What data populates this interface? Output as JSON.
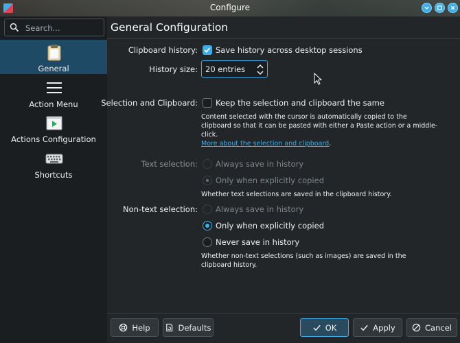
{
  "window": {
    "title": "Configure"
  },
  "search": {
    "placeholder": "Search..."
  },
  "sidebar": {
    "items": [
      {
        "label": "General",
        "icon": "clipboard-icon",
        "selected": true
      },
      {
        "label": "Action Menu",
        "icon": "menu-lines-icon",
        "selected": false
      },
      {
        "label": "Actions Configuration",
        "icon": "play-window-icon",
        "selected": false
      },
      {
        "label": "Shortcuts",
        "icon": "keyboard-icon",
        "selected": false
      }
    ]
  },
  "page": {
    "title": "General Configuration"
  },
  "clipboard_history": {
    "label": "Clipboard history:",
    "option": "Save history across desktop sessions",
    "checked": true
  },
  "history_size": {
    "label": "History size:",
    "value": "20 entries"
  },
  "selection_clipboard": {
    "label": "Selection and Clipboard:",
    "option": "Keep the selection and clipboard the same",
    "checked": false,
    "note": "Content selected with the cursor is automatically copied to the clipboard so that it can be pasted with either a Paste action or a middle-click.",
    "link": "More about the selection and clipboard",
    "link_suffix": "."
  },
  "text_selection": {
    "label": "Text selection:",
    "options": [
      "Always save in history",
      "Only when explicitly copied"
    ],
    "selected_index": 1,
    "disabled": true,
    "note": "Whether text selections are saved in the clipboard history."
  },
  "nontext_selection": {
    "label": "Non-text selection:",
    "options": [
      "Always save in history",
      "Only when explicitly copied",
      "Never save in history"
    ],
    "selected_index": 1,
    "note": "Whether non-text selections (such as images) are saved in the clipboard history."
  },
  "buttons": {
    "help": "Help",
    "defaults": "Defaults",
    "ok": "OK",
    "apply": "Apply",
    "cancel": "Cancel"
  },
  "colors": {
    "accent": "#3daee9",
    "background": "#232629",
    "sidebar": "#1b1e20",
    "selected": "#1f4a65"
  }
}
